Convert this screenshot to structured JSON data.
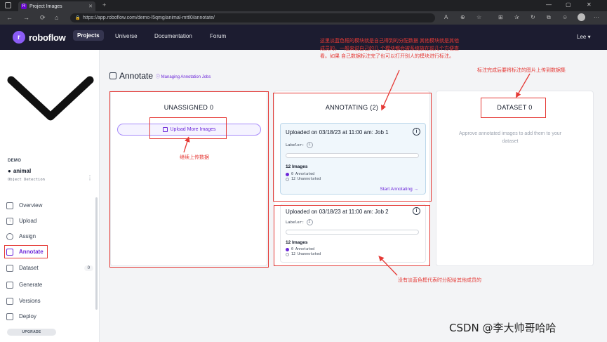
{
  "browser": {
    "tab_title": "Project Images",
    "url": "https://app.roboflow.com/demo-l5qmg/animal-mttl0/annotate/",
    "tab_close": "✕",
    "new_tab": "+"
  },
  "nav": {
    "brand": "roboflow",
    "links": [
      "Projects",
      "Universe",
      "Documentation",
      "Forum"
    ],
    "user": "Lee ▾"
  },
  "sidebar": {
    "workspace": "DEMO",
    "project_name": "animal",
    "project_type": "Object Detection",
    "items": [
      {
        "label": "Overview",
        "icon": "overview-icon"
      },
      {
        "label": "Upload",
        "icon": "upload-icon"
      },
      {
        "label": "Assign",
        "icon": "search-icon"
      },
      {
        "label": "Annotate",
        "icon": "annotate-icon"
      },
      {
        "label": "Dataset",
        "icon": "dataset-icon",
        "badge": "0"
      },
      {
        "label": "Generate",
        "icon": "generate-icon"
      },
      {
        "label": "Versions",
        "icon": "versions-icon"
      },
      {
        "label": "Deploy",
        "icon": "deploy-icon"
      }
    ],
    "upgrade": "UPGRADE"
  },
  "main": {
    "title": "Annotate",
    "help_link": "Managing Annotation Jobs",
    "unassigned": {
      "title": "UNASSIGNED 0",
      "upload_button": "Upload More Images"
    },
    "annotating": {
      "title": "ANNOTATING (2)",
      "jobs": [
        {
          "title": "Uploaded on 03/18/23 at 11:00 am: Job 1",
          "labeler_label": "Labeler:",
          "labeler_avatar": "L",
          "images": "12 Images",
          "annotated": "0 Annotated",
          "unannotated": "12 Unannotated",
          "action": "Start Annotating →"
        },
        {
          "title": "Uploaded on 03/18/23 at 11:00 am: Job 2",
          "labeler_label": "Labeler:",
          "labeler_avatar": "2",
          "images": "12 Images",
          "annotated": "0 Annotated",
          "unannotated": "12 Unannotated"
        }
      ]
    },
    "dataset": {
      "title": "DATASET 0",
      "empty_message": "Approve annotated images to add them to your dataset"
    }
  },
  "annotations": {
    "top_note": "这里淡蓝色框的模块就是自己得到的分配数据 其他模块就是其他成员的，一般来说自己的几 个模块都会被系统放在前几个方便查看。如果 自己数据标注完了也可以打开别人的模块进行标注。",
    "dataset_note": "标注完成后要将标注的图片上传到数据集",
    "upload_note": "继续上传数据",
    "bottom_note": "没有淡蓝色框代表时分配给其他成员的"
  },
  "watermark": "CSDN @李大帅哥哈哈",
  "colors": {
    "accent": "#6d28d9",
    "nav_bg": "#1c1c30",
    "annotation_red": "#e53935",
    "own_job_bg": "#f0f7fc"
  }
}
